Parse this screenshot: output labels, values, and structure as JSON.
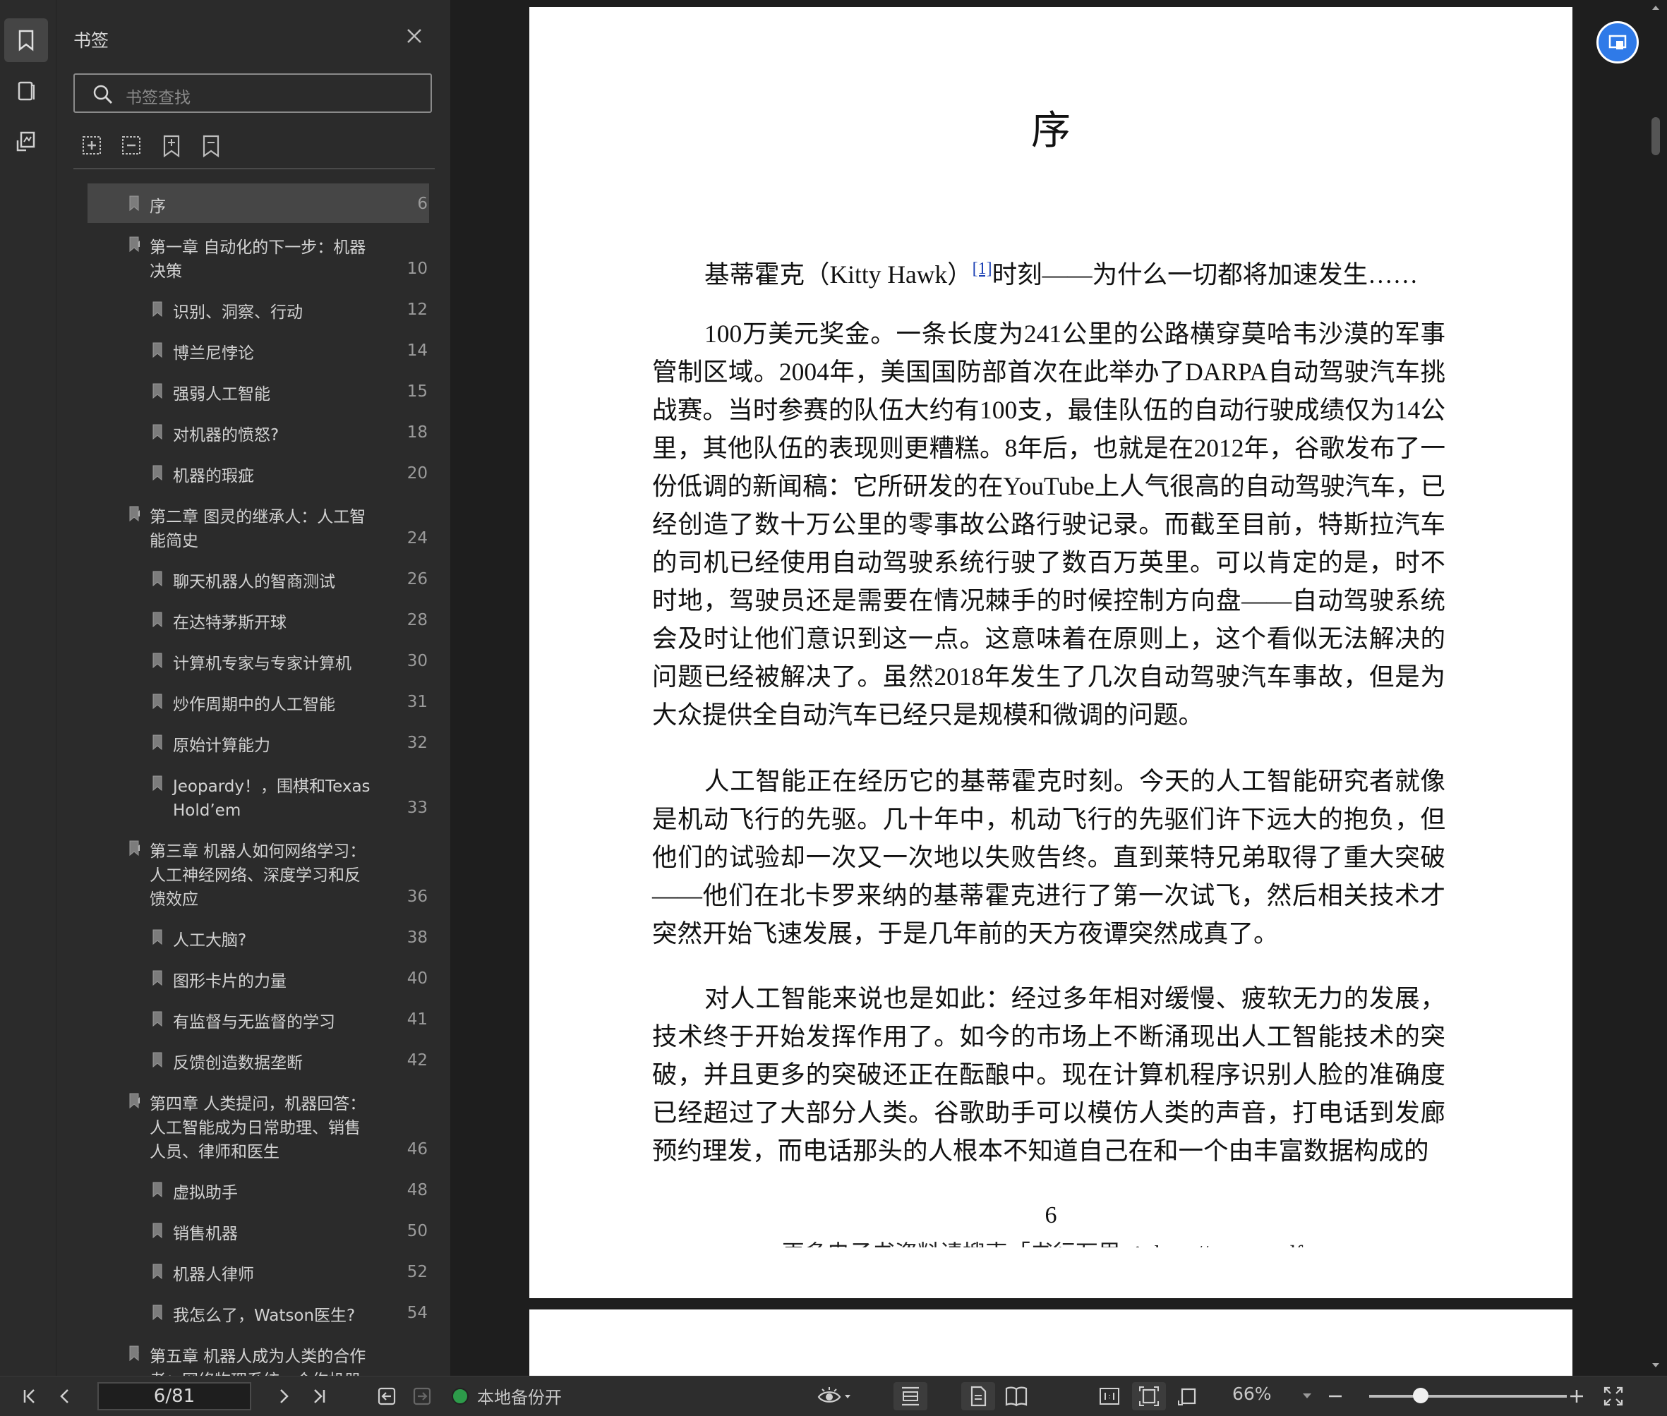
{
  "sidebar": {
    "title": "书签",
    "search_placeholder": "书签查找",
    "bookmarks": [
      {
        "label": "序",
        "page": "6",
        "level": 0,
        "selected": true,
        "expand": "none"
      },
      {
        "label": "第一章 自动化的下一步：机器决策",
        "page": "10",
        "level": 0,
        "expand": "open"
      },
      {
        "label": "识别、洞察、行动",
        "page": "12",
        "level": 1
      },
      {
        "label": "博兰尼悖论",
        "page": "14",
        "level": 1
      },
      {
        "label": "强弱人工智能",
        "page": "15",
        "level": 1
      },
      {
        "label": "对机器的愤怒?",
        "page": "18",
        "level": 1
      },
      {
        "label": "机器的瑕疵",
        "page": "20",
        "level": 1
      },
      {
        "label": "第二章 图灵的继承人：人工智能简史",
        "page": "24",
        "level": 0,
        "expand": "open"
      },
      {
        "label": "聊天机器人的智商测试",
        "page": "26",
        "level": 1
      },
      {
        "label": "在达特茅斯开球",
        "page": "28",
        "level": 1
      },
      {
        "label": "计算机专家与专家计算机",
        "page": "30",
        "level": 1
      },
      {
        "label": "炒作周期中的人工智能",
        "page": "31",
        "level": 1
      },
      {
        "label": "原始计算能力",
        "page": "32",
        "level": 1
      },
      {
        "label": "Jeopardy！，围棋和Texas Hold’em",
        "page": "33",
        "level": 1
      },
      {
        "label": "第三章 机器人如何网络学习：人工神经网络、深度学习和反馈效应",
        "page": "36",
        "level": 0,
        "expand": "open"
      },
      {
        "label": "人工大脑?",
        "page": "38",
        "level": 1
      },
      {
        "label": "图形卡片的力量",
        "page": "40",
        "level": 1
      },
      {
        "label": "有监督与无监督的学习",
        "page": "41",
        "level": 1
      },
      {
        "label": "反馈创造数据垄断",
        "page": "42",
        "level": 1
      },
      {
        "label": "第四章 人类提问，机器回答：人工智能成为日常助理、销售人员、律师和医生",
        "page": "46",
        "level": 0,
        "expand": "open"
      },
      {
        "label": "虚拟助手",
        "page": "48",
        "level": 1
      },
      {
        "label": "销售机器",
        "page": "50",
        "level": 1
      },
      {
        "label": "机器人律师",
        "page": "52",
        "level": 1
      },
      {
        "label": "我怎么了，Watson医生?",
        "page": "54",
        "level": 1
      },
      {
        "label": "第五章 机器人成为人类的合作者：网络物理系统、合作机器",
        "page": "",
        "level": 0,
        "expand": "closed"
      }
    ]
  },
  "document": {
    "title": "序",
    "intro_text": "基蒂霍克（Kitty Hawk）",
    "intro_note": "[1]",
    "intro_rest": "时刻——为什么一切都将加速发生……",
    "paragraphs": [
      "100万美元奖金。一条长度为241公里的公路横穿莫哈韦沙漠的军事管制区域。2004年，美国国防部首次在此举办了DARPA自动驾驶汽车挑战赛。当时参赛的队伍大约有100支，最佳队伍的自动行驶成绩仅为14公里，其他队伍的表现则更糟糕。8年后，也就是在2012年，谷歌发布了一份低调的新闻稿：它所研发的在YouTube上人气很高的自动驾驶汽车，已经创造了数十万公里的零事故公路行驶记录。而截至目前，特斯拉汽车的司机已经使用自动驾驶系统行驶了数百万英里。可以肯定的是，时不时地，驾驶员还是需要在情况棘手的时候控制方向盘——自动驾驶系统会及时让他们意识到这一点。这意味着在原则上，这个看似无法解决的问题已经被解决了。虽然2018年发生了几次自动驾驶汽车事故，但是为大众提供全自动汽车已经只是规模和微调的问题。",
      "人工智能正在经历它的基蒂霍克时刻。今天的人工智能研究者就像是机动飞行的先驱。几十年中，机动飞行的先驱们许下远大的抱负，但他们的试验却一次又一次地以失败告终。直到莱特兄弟取得了重大突破——他们在北卡罗来纳的基蒂霍克进行了第一次试飞，然后相关技术才突然开始飞速发展，于是几年前的天方夜谭突然成真了。",
      "对人工智能来说也是如此：经过多年相对缓慢、疲软无力的发展，技术终于开始发挥作用了。如今的市场上不断涌现出人工智能技术的突破，并且更多的突破还正在酝酿中。现在计算机程序识别人脸的准确度已经超过了大部分人类。谷歌助手可以模仿人类的声音，打电话到发廊预约理发，而电话那头的人根本不知道自己在和一个由丰富数据构成的"
    ],
    "page_number": "6",
    "footer": "更多电子书资料请搜索「书行万里」：http://www.gpdf.n"
  },
  "statusbar": {
    "page_indicator": "6/81",
    "backup_label": "本地备份开",
    "zoom": "66%",
    "zoom_level_fraction": 0.26
  }
}
